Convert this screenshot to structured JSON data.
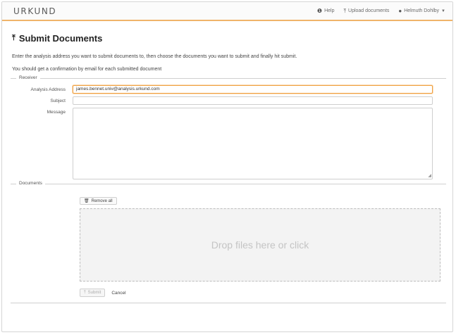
{
  "header": {
    "logo": "URKUND",
    "help_label": "Help",
    "help_icon": "info-circle-icon",
    "upload_label": "Upload documents",
    "upload_icon": "upload-icon",
    "user_label": "Helmuth Dohlby",
    "user_icon": "user-icon",
    "accent_color": "#f0b46a"
  },
  "page": {
    "title": "Submit Documents",
    "intro_line1": "Enter the analysis address you want to submit documents to, then choose the documents you want to submit and finally hit submit.",
    "intro_line2": "You should get a confirmation by email for each submitted document"
  },
  "receiver": {
    "legend": "Receiver",
    "analysis_label": "Analysis Address",
    "analysis_value": "james.bennet.univ@analysis.urkund.com",
    "subject_label": "Subject",
    "subject_value": "",
    "message_label": "Message",
    "message_value": ""
  },
  "documents": {
    "legend": "Documents",
    "remove_all_label": "Remove all",
    "drop_text": "Drop files here or click",
    "submit_label": "Submit",
    "cancel_label": "Cancel"
  }
}
